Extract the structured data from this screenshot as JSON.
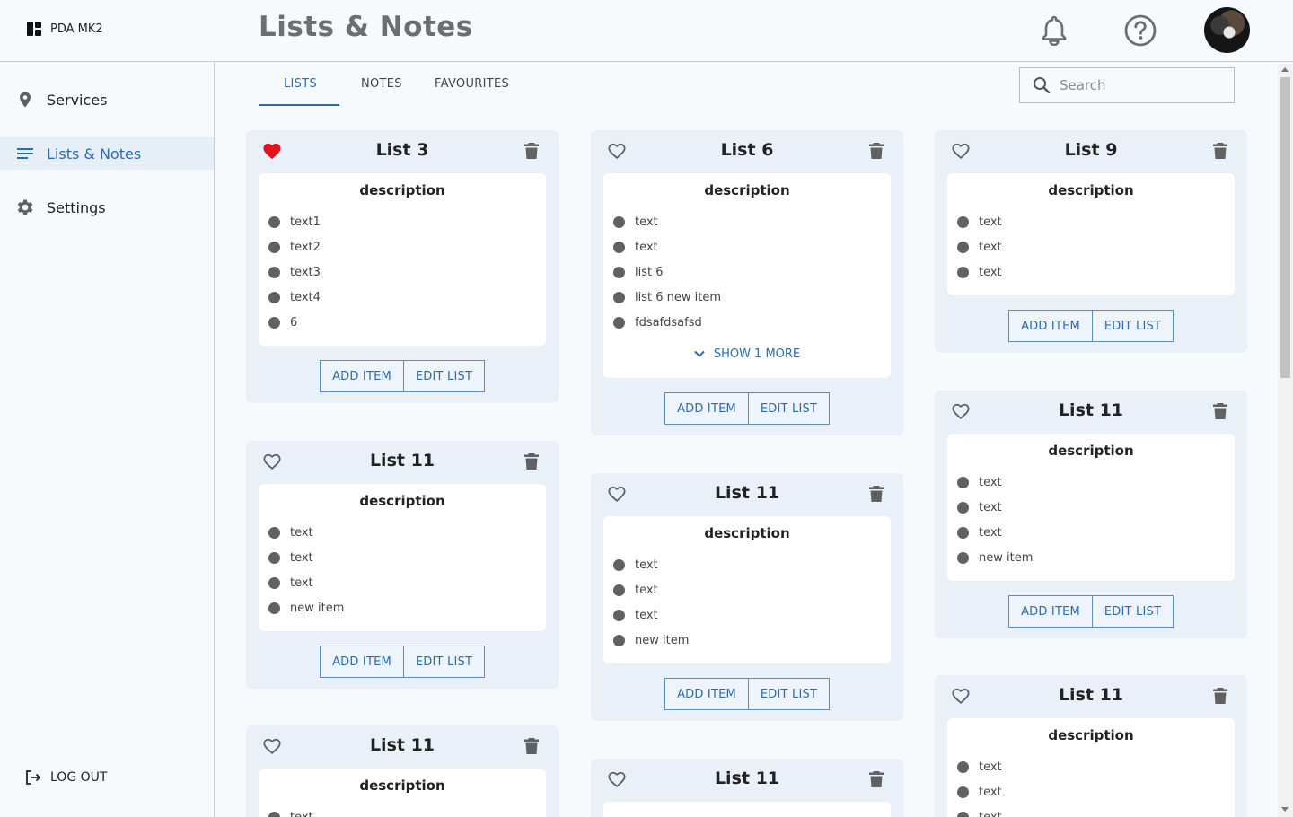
{
  "app": {
    "name": "PDA MK2",
    "title": "Lists & Notes"
  },
  "sidebar": {
    "items": [
      {
        "label": "Services",
        "icon": "location-pin-icon"
      },
      {
        "label": "Lists & Notes",
        "icon": "lines-icon",
        "active": true
      },
      {
        "label": "Settings",
        "icon": "gear-icon"
      }
    ],
    "logout": "LOG OUT"
  },
  "tabs": [
    {
      "label": "LISTS",
      "active": true
    },
    {
      "label": "NOTES"
    },
    {
      "label": "FAVOURITES"
    }
  ],
  "search": {
    "placeholder": "Search"
  },
  "buttons": {
    "add": "ADD ITEM",
    "edit": "EDIT LIST"
  },
  "colors": {
    "accent": "#2c6bb0",
    "favourite": "#e0141b",
    "card": "#e9f0f8"
  },
  "cards": [
    {
      "title": "List 3",
      "favourite": true,
      "description": "description",
      "items": [
        "text1",
        "text2",
        "text3",
        "text4",
        "6"
      ]
    },
    {
      "title": "List 11",
      "favourite": false,
      "description": "description",
      "items": [
        "text",
        "text",
        "text",
        "new item"
      ]
    },
    {
      "title": "List 11",
      "favourite": false,
      "description": "description",
      "items": [
        "text"
      ]
    },
    {
      "title": "List 6",
      "favourite": false,
      "description": "description",
      "items": [
        "text",
        "text",
        "list 6",
        "list 6 new item",
        "fdsafdsafsd"
      ],
      "show_more": "SHOW 1 MORE"
    },
    {
      "title": "List 11",
      "favourite": false,
      "description": "description",
      "items": [
        "text",
        "text",
        "text",
        "new item"
      ]
    },
    {
      "title": "List 11",
      "favourite": false
    },
    {
      "title": "List 9",
      "favourite": false,
      "description": "description",
      "items": [
        "text",
        "text",
        "text"
      ]
    },
    {
      "title": "List 11",
      "favourite": false,
      "description": "description",
      "items": [
        "text",
        "text",
        "text",
        "new item"
      ]
    },
    {
      "title": "List 11",
      "favourite": false,
      "description": "description",
      "items": [
        "text",
        "text",
        "text"
      ]
    }
  ]
}
